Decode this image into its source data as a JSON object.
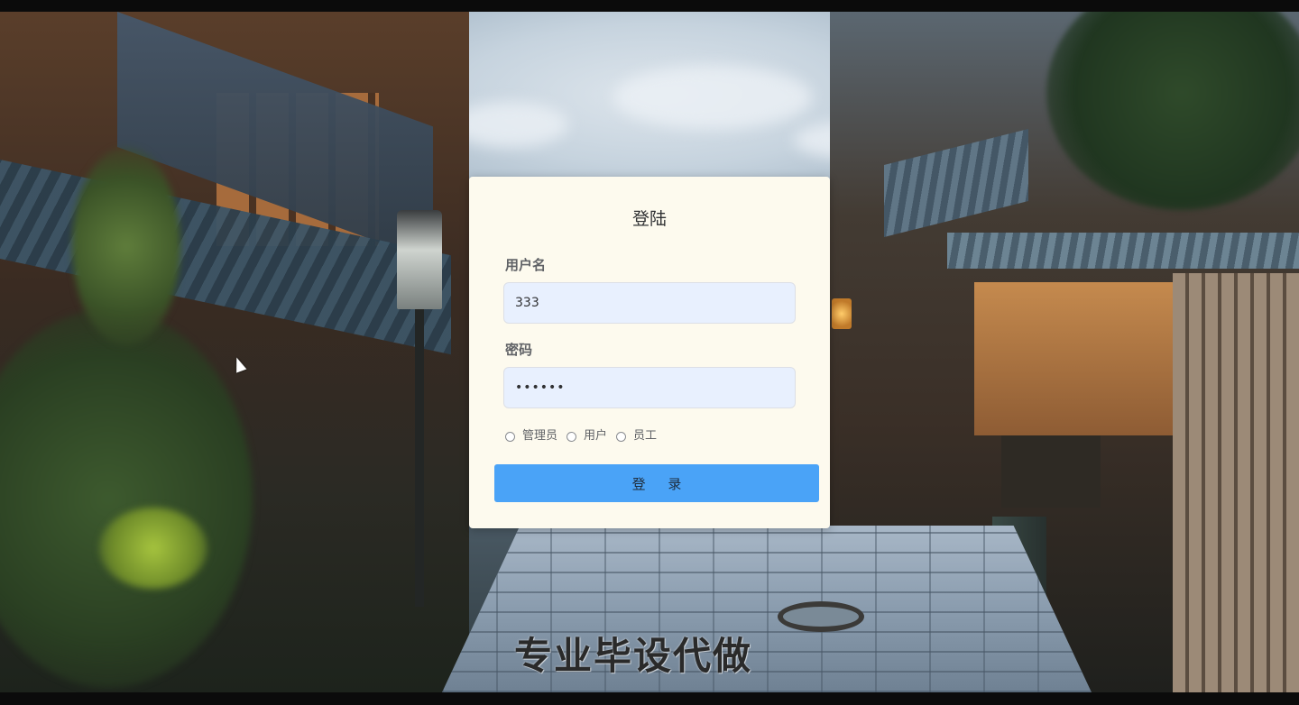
{
  "login": {
    "title": "登陆",
    "username_label": "用户名",
    "username_value": "333",
    "password_label": "密码",
    "password_value": "••••••",
    "roles": [
      {
        "label": "管理员",
        "selected": false
      },
      {
        "label": "用户",
        "selected": false
      },
      {
        "label": "员工",
        "selected": false
      }
    ],
    "submit_label": "登 录"
  },
  "overlay": {
    "watermark_text": "专业毕设代做"
  },
  "colors": {
    "card_background": "#fdfaee",
    "input_background": "#e8f0fe",
    "button_accent": "#4aa3f7"
  }
}
